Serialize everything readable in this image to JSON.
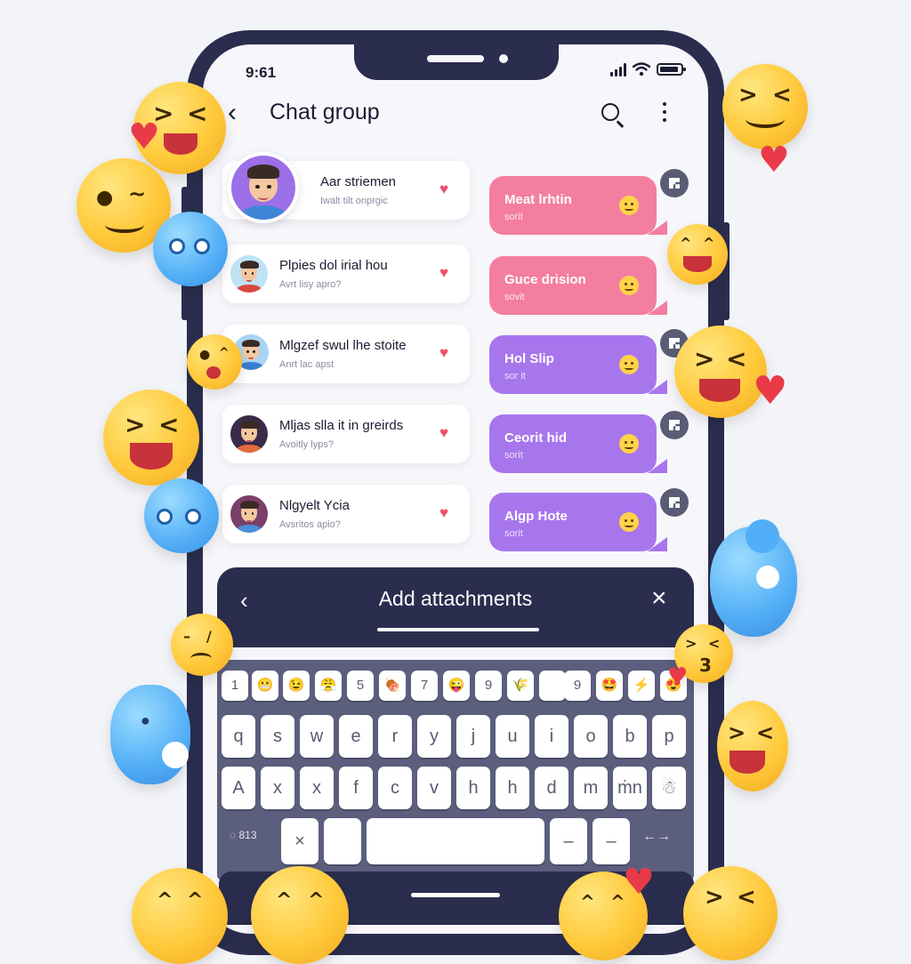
{
  "status_bar": {
    "time": "9:61"
  },
  "header": {
    "title": "Chat group"
  },
  "chats": [
    {
      "name": "Aar striemen",
      "subtitle": "Iwalt tilt onprgic"
    },
    {
      "name": "Plpies dol irial hou",
      "subtitle": "Avrt lisy apro?"
    },
    {
      "name": "Mlgzef swul lhe stoite",
      "subtitle": "Anrt lac apst"
    },
    {
      "name": "Mljas slla it in greirds",
      "subtitle": "Avoitly lyps?"
    },
    {
      "name": "Nlgyelt Ycia",
      "subtitle": "Avsritos apio?"
    }
  ],
  "bubbles": [
    {
      "text": "Meat lrhtin",
      "sub": "sorit",
      "color": "pink"
    },
    {
      "text": "Guce drision",
      "sub": "sovit",
      "color": "pink"
    },
    {
      "text": "Hol Slip",
      "sub": "sor it",
      "color": "purple"
    },
    {
      "text": "Ceorit hid",
      "sub": "sorit",
      "color": "purple"
    },
    {
      "text": "Algp Hote",
      "sub": "sorit",
      "color": "purple"
    }
  ],
  "attachments": {
    "title": "Add attachments"
  },
  "keyboard": {
    "row0": [
      "1",
      "😬",
      "😉",
      "😤",
      "5",
      "🍖",
      "7",
      "😜",
      "9",
      "🌾",
      "",
      "9",
      "🤩",
      "⚡",
      "😍"
    ],
    "row1": [
      "q",
      "s",
      "w",
      "e",
      "r",
      "y",
      "j",
      "u",
      "i",
      "o",
      "b",
      "p"
    ],
    "row2": [
      "A",
      "x",
      "x",
      "f",
      "c",
      "v",
      "h",
      "h",
      "d",
      "m",
      "ṁn",
      "☃"
    ],
    "row3_left": "◌ 813",
    "row3_keys": [
      "×",
      "",
      "",
      "–",
      "–"
    ],
    "row3_right": "←→"
  },
  "colors": {
    "frame": "#2b2d4e",
    "pink": "#f47ea0",
    "purple": "#a776ec",
    "heart": "#ee4f6f"
  }
}
